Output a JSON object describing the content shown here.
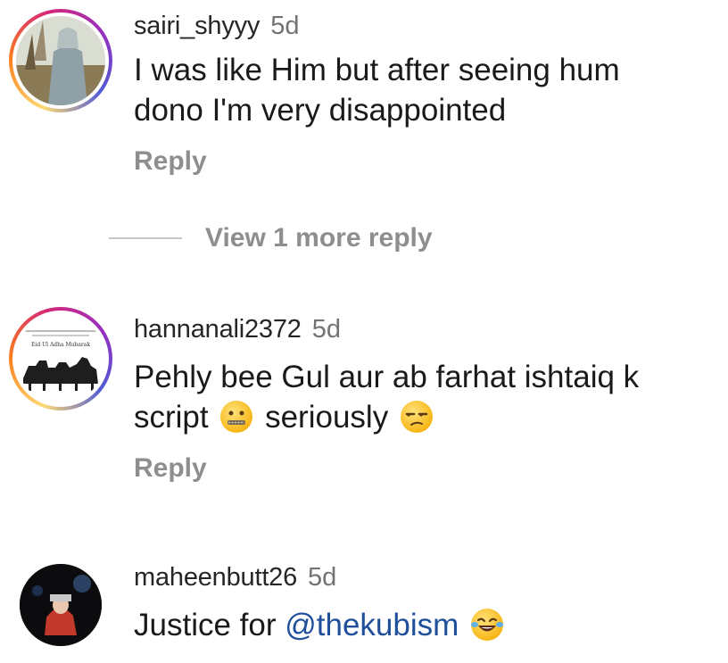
{
  "comments": [
    {
      "username": "sairi_shyyy",
      "age": "5d",
      "text_lines": [
        "I was like Him but after seeing hum",
        "dono I'm very disappointed"
      ],
      "reply_label": "Reply",
      "has_story_ring": true
    },
    {
      "username": "hannanali2372",
      "age": "5d",
      "text_line1": "Pehly bee Gul aur ab farhat ishtaiq k",
      "text_line2_a": "script",
      "text_line2_b": "seriously",
      "emojis": [
        "zipper-mouth-face-emoji",
        "unamused-face-emoji"
      ],
      "avatar_caption": "Eid Ul Adha Mubarak",
      "reply_label": "Reply",
      "has_story_ring": true
    },
    {
      "username": "maheenbutt26",
      "age": "5d",
      "text_prefix": "Justice for ",
      "mention": "@thekubism",
      "emojis": [
        "face-with-tears-of-joy-emoji"
      ],
      "has_story_ring": false
    }
  ],
  "view_more": {
    "label": "View 1 more reply"
  },
  "colors": {
    "username": "#262626",
    "secondary_text": "#8e8e8e",
    "mention": "#1f4e9a",
    "story_ring": [
      "#feda75",
      "#fa7e1e",
      "#d62976",
      "#962fbf",
      "#4f5bd5"
    ]
  }
}
